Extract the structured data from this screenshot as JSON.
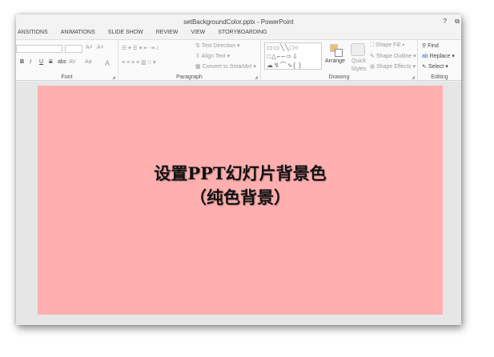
{
  "window": {
    "title": "setBackgroundColor.pptx - PowerPoint",
    "help": "?",
    "restore": "⧉"
  },
  "tabs": [
    "ANSITIONS",
    "ANIMATIONS",
    "SLIDE SHOW",
    "REVIEW",
    "VIEW",
    "STORYBOARDING"
  ],
  "ribbon": {
    "font": {
      "label": "Font",
      "bold": "B",
      "italic": "I",
      "underline": "U",
      "strike": "S",
      "abc": "abc",
      "spacing": "AV",
      "case": "Aa",
      "color": "A",
      "grow": "A˄",
      "shrink": "A˅"
    },
    "paragraph": {
      "label": "Paragraph",
      "text_direction": "Text Direction",
      "align_text": "Align Text",
      "convert_smartart": "Convert to SmartArt"
    },
    "drawing": {
      "label": "Drawing",
      "arrange": "Arrange",
      "quick_styles": "Quick Styles",
      "shape_fill": "Shape Fill",
      "shape_outline": "Shape Outline",
      "shape_effects": "Shape Effects",
      "shapes": "▭▭╲╲□○\n□△⌐⌐⇨⇩\n☁↯⌒∿{ }"
    },
    "editing": {
      "label": "Editing",
      "find": "Find",
      "replace": "Replace",
      "select": "Select"
    }
  },
  "slide": {
    "line1": "设置PPT幻灯片背景色",
    "line2": "（纯色背景）",
    "background": "#ffafaf"
  }
}
